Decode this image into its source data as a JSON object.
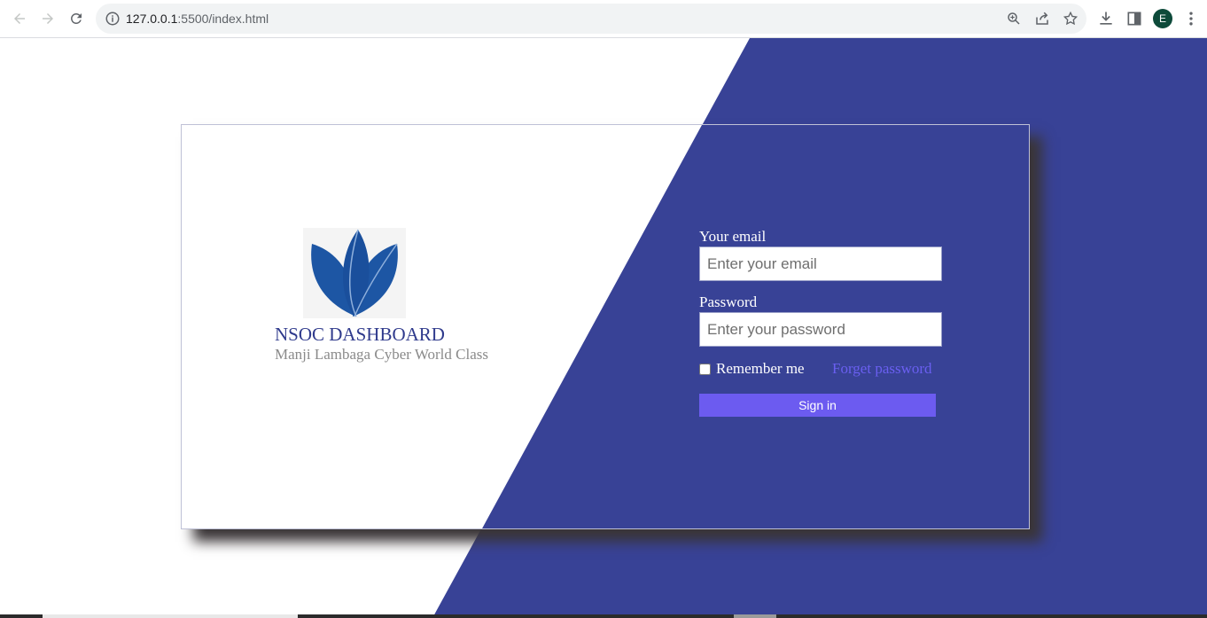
{
  "browser": {
    "url_host": "127.0.0.1",
    "url_rest": ":5500/index.html",
    "profile_initial": "E"
  },
  "brand": {
    "title": "NSOC DASHBOARD",
    "subtitle": "Manji Lambaga Cyber World Class",
    "logo_icon": "lotus-logo"
  },
  "login": {
    "email_label": "Your email",
    "email_placeholder": "Enter your email",
    "email_value": "",
    "password_label": "Password",
    "password_placeholder": "Enter your password",
    "password_value": "",
    "remember_label": "Remember me",
    "remember_checked": false,
    "forgot_label": "Forget password",
    "signin_label": "Sign in"
  },
  "colors": {
    "primary": "#384296",
    "button": "#6c5bf0",
    "link": "#6a5ff0"
  }
}
